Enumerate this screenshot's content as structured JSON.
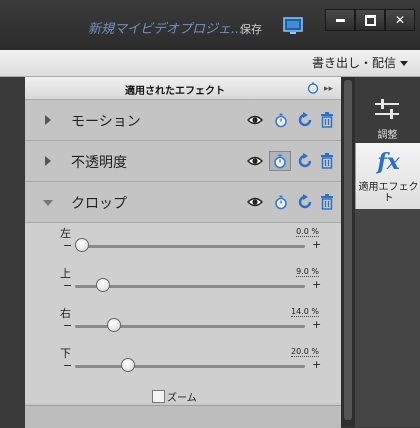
{
  "titlebar": {
    "project_title": "新規マイビデオプロジェ...",
    "save_label": "保存"
  },
  "toolbar": {
    "export_label": "書き出し・配信"
  },
  "panel": {
    "title": "適用されたエフェクト",
    "effects": [
      {
        "name": "モーション",
        "expanded": false,
        "stopwatch_active": false
      },
      {
        "name": "不透明度",
        "expanded": false,
        "stopwatch_active": true
      },
      {
        "name": "クロップ",
        "expanded": true,
        "stopwatch_active": false
      }
    ],
    "crop_controls": [
      {
        "label": "左",
        "value": "0.0",
        "unit": "%",
        "value_text": "0.0 %",
        "level": 0.0
      },
      {
        "label": "上",
        "value": "9.0",
        "unit": "%",
        "value_text": "9.0 %",
        "level": 0.09
      },
      {
        "label": "右",
        "value": "14.0",
        "unit": "%",
        "value_text": "14.0 %",
        "level": 0.14
      },
      {
        "label": "下",
        "value": "20.0",
        "unit": "%",
        "value_text": "20.0 %",
        "level": 0.2
      }
    ],
    "minus_glyph": "−",
    "plus_glyph": "+",
    "zoom_label": "ズーム",
    "zoom_checked": false
  },
  "sidebar": {
    "adjust_label": "調整",
    "fx_glyph": "fx",
    "applied_effects_label": "適用エフェクト"
  },
  "colors": {
    "accent_blue": "#2a6fc9",
    "title_blue": "#6f93c4"
  }
}
